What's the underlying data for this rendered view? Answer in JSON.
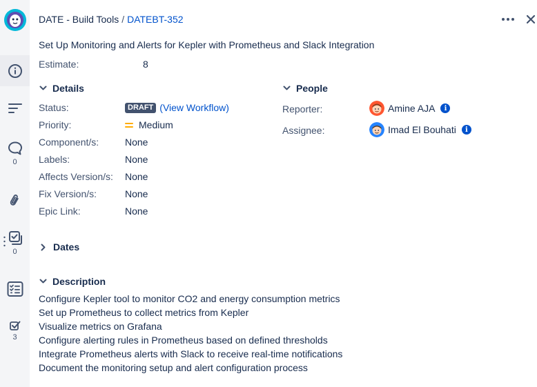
{
  "rail": {
    "comments_count": "0",
    "subtasks_count": "0",
    "checklist_count": "3"
  },
  "header": {
    "project": "DATE - Build Tools",
    "separator": "/",
    "issue_key": "DATEBT-352"
  },
  "summary": "Set Up Monitoring and Alerts for Kepler with Prometheus and Slack Integration",
  "estimate": {
    "label": "Estimate:",
    "value": "8"
  },
  "details": {
    "title": "Details",
    "status_label": "Status:",
    "status_lozenge": "DRAFT",
    "view_workflow": "(View Workflow)",
    "priority_label": "Priority:",
    "priority_value": "Medium",
    "components_label": "Component/s:",
    "components_value": "None",
    "labels_label": "Labels:",
    "labels_value": "None",
    "affects_label": "Affects Version/s:",
    "affects_value": "None",
    "fix_label": "Fix Version/s:",
    "fix_value": "None",
    "epic_label": "Epic Link:",
    "epic_value": "None"
  },
  "people": {
    "title": "People",
    "reporter_label": "Reporter:",
    "reporter_name": "Amine AJA",
    "assignee_label": "Assignee:",
    "assignee_name": "Imad El Bouhati"
  },
  "dates": {
    "title": "Dates"
  },
  "description": {
    "title": "Description",
    "lines": [
      "Configure Kepler tool to monitor CO2 and energy consumption metrics",
      "Set up Prometheus to collect metrics from Kepler",
      "Visualize metrics on Grafana",
      "Configure alerting rules in Prometheus based on defined thresholds",
      "Integrate Prometheus alerts with Slack to receive real-time notifications",
      "Document the monitoring setup and alert configuration process"
    ]
  },
  "colors": {
    "accent": "#0052cc",
    "lozenge": "#42526e",
    "priority_medium": "#ffab00",
    "rail_bg": "#f4f5f7"
  },
  "icons": {
    "logo": "app-logo-icon",
    "details_tab": "info-icon",
    "activity_tab": "lines-icon",
    "comments_tab": "comment-icon",
    "attachments_tab": "paperclip-icon",
    "subtasks_tab": "subtasks-icon",
    "checklist_tab": "checklist-icon",
    "todo_tab": "checkbox-icon",
    "more": "more-icon",
    "close": "close-icon"
  }
}
